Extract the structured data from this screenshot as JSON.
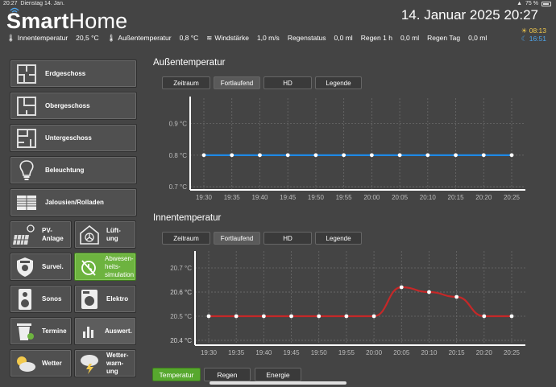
{
  "status_bar": {
    "time": "20:27",
    "date": "Dienstag 14. Jan.",
    "battery": "75 %"
  },
  "header": {
    "logo_bold": "Smart",
    "logo_light": "Home",
    "datetime": "14. Januar 2025  20:27",
    "sunrise": "08:13",
    "sunset": "16:51"
  },
  "info": {
    "inner_label": "Innentemperatur",
    "inner_value": "20,5 °C",
    "outer_label": "Außentemperatur",
    "outer_value": "0,8 °C",
    "wind_label": "Windstärke",
    "wind_value": "1,0 m/s",
    "rain_status_label": "Regenstatus",
    "rain_status_value": "0,0 ml",
    "rain_hour_label": "Regen 1 h",
    "rain_hour_value": "0,0 ml",
    "rain_day_label": "Regen Tag",
    "rain_day_value": "0,0 ml"
  },
  "nav": {
    "erdgeschoss": "Erdgeschoss",
    "obergeschoss": "Obergeschoss",
    "untergeschoss": "Untergeschoss",
    "beleuchtung": "Beleuchtung",
    "jalousien": "Jalousien/Rolladen",
    "pv": "PV-\nAnlage",
    "lueftung": "Lüft-\nung",
    "survei": "Survei.",
    "abwesenheit": "Abwesen-\nheits-\nsimulation",
    "sonos": "Sonos",
    "elektro": "Elektro",
    "termine": "Termine",
    "auswert": "Auswert.",
    "wetter": "Wetter",
    "wetterwarnung": "Wetter-\nwarn-\nung"
  },
  "toolbar": {
    "zeitraum": "Zeitraum",
    "fortlaufend": "Fortlaufend",
    "hd": "HD",
    "legende": "Legende"
  },
  "bottom_tabs": {
    "temperatur": "Temperatur",
    "regen": "Regen",
    "energie": "Energie"
  },
  "colors": {
    "accent_green": "#6db33f",
    "outer_line": "#1e88e5",
    "inner_line": "#c62828"
  },
  "chart_data": [
    {
      "type": "line",
      "title": "Außentemperatur",
      "x": [
        "19:30",
        "19:35",
        "19:40",
        "19:45",
        "19:50",
        "19:55",
        "20:00",
        "20:05",
        "20:10",
        "20:15",
        "20:20",
        "20:25"
      ],
      "series": [
        {
          "values": [
            0.8,
            0.8,
            0.8,
            0.8,
            0.8,
            0.8,
            0.8,
            0.8,
            0.8,
            0.8,
            0.8,
            0.8
          ]
        }
      ],
      "yticks": [
        "0.7 °C",
        "0.8 °C",
        "0.9 °C"
      ],
      "ylim": [
        0.69,
        0.95
      ],
      "grid": true,
      "color": "#1e88e5"
    },
    {
      "type": "line",
      "title": "Innentemperatur",
      "x": [
        "19:30",
        "19:35",
        "19:40",
        "19:45",
        "19:50",
        "19:55",
        "20:00",
        "20:05",
        "20:10",
        "20:15",
        "20:20",
        "20:25"
      ],
      "series": [
        {
          "values": [
            20.5,
            20.5,
            20.5,
            20.5,
            20.5,
            20.5,
            20.5,
            20.62,
            20.6,
            20.58,
            20.5,
            20.5
          ]
        }
      ],
      "yticks": [
        "20.4 °C",
        "20.4 °C",
        "20.5 °C",
        "20.6 °C",
        "20.6 °C",
        "20.7 °C"
      ],
      "ylim": [
        20.38,
        20.73
      ],
      "grid": true,
      "color": "#c62828"
    }
  ]
}
